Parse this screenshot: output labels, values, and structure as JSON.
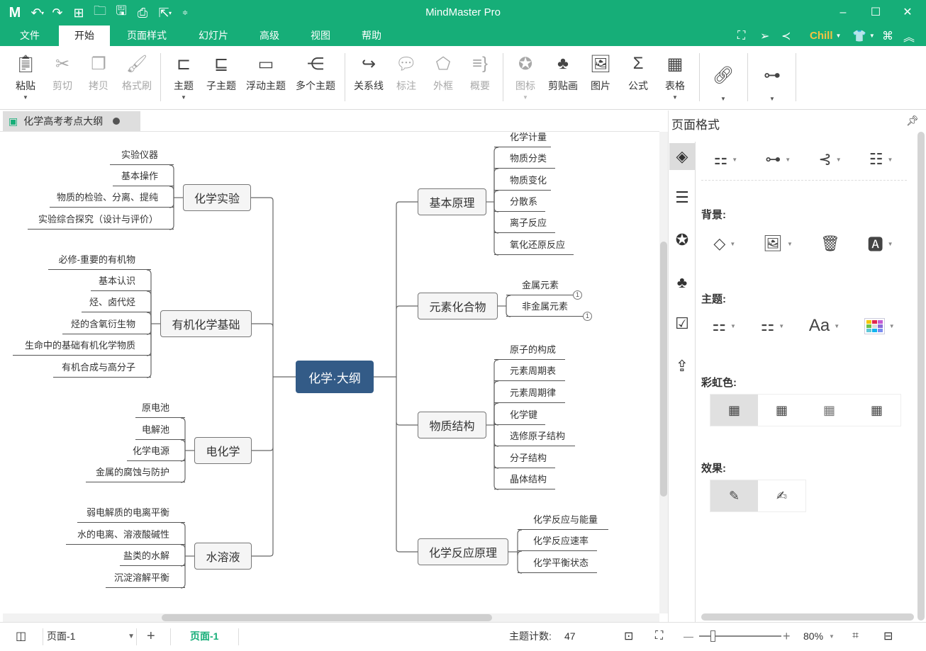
{
  "app": {
    "title": "MindMaster Pro",
    "logo": "M"
  },
  "quick_access": [
    "undo-icon",
    "redo-icon",
    "new-icon",
    "open-icon",
    "save-icon",
    "print-icon",
    "export-icon",
    "customize-icon"
  ],
  "menus": [
    "文件",
    "开始",
    "页面样式",
    "幻灯片",
    "高级",
    "视图",
    "帮助"
  ],
  "active_menu": "开始",
  "theme_label": "Chill",
  "ribbon": {
    "clipboard": [
      {
        "label": "粘贴",
        "icon": "paste-icon",
        "enabled": true,
        "dropdown": true
      },
      {
        "label": "剪切",
        "icon": "cut-icon",
        "enabled": false
      },
      {
        "label": "拷贝",
        "icon": "copy-icon",
        "enabled": false
      },
      {
        "label": "格式刷",
        "icon": "format-painter-icon",
        "enabled": false
      }
    ],
    "topics": [
      {
        "label": "主题",
        "icon": "topic-icon",
        "enabled": true,
        "dropdown": true
      },
      {
        "label": "子主题",
        "icon": "subtopic-icon",
        "enabled": true
      },
      {
        "label": "浮动主题",
        "icon": "floating-topic-icon",
        "enabled": true
      },
      {
        "label": "多个主题",
        "icon": "multiple-topics-icon",
        "enabled": true
      }
    ],
    "annotate": [
      {
        "label": "关系线",
        "icon": "relationship-icon",
        "enabled": true
      },
      {
        "label": "标注",
        "icon": "callout-icon",
        "enabled": false
      },
      {
        "label": "外框",
        "icon": "boundary-icon",
        "enabled": false
      },
      {
        "label": "概要",
        "icon": "summary-icon",
        "enabled": false
      }
    ],
    "insert": [
      {
        "label": "图标",
        "icon": "mark-icon",
        "enabled": false,
        "dropdown": true
      },
      {
        "label": "剪贴画",
        "icon": "clipart-icon",
        "enabled": true
      },
      {
        "label": "图片",
        "icon": "picture-icon",
        "enabled": true
      },
      {
        "label": "公式",
        "icon": "formula-icon",
        "enabled": true
      },
      {
        "label": "表格",
        "icon": "table-icon",
        "enabled": true,
        "dropdown": true
      }
    ],
    "extra": [
      {
        "label": "",
        "icon": "link-icon",
        "dropdown": true
      },
      {
        "label": "",
        "icon": "layout-icon",
        "dropdown": true
      }
    ]
  },
  "document_tab": {
    "title": "化学高考考点大纲",
    "modified": true
  },
  "mindmap": {
    "root": "化学·大纲",
    "left": [
      {
        "title": "化学实验",
        "children": [
          "实验仪器",
          "基本操作",
          "物质的检验、分离、提纯",
          "实验综合探究（设计与评价）"
        ]
      },
      {
        "title": "有机化学基础",
        "children": [
          "必修-重要的有机物",
          "基本认识",
          "烃、卤代烃",
          "烃的含氧衍生物",
          "生命中的基础有机化学物质",
          "有机合成与高分子"
        ]
      },
      {
        "title": "电化学",
        "children": [
          "原电池",
          "电解池",
          "化学电源",
          "金属的腐蚀与防护"
        ]
      },
      {
        "title": "水溶液",
        "children": [
          "弱电解质的电离平衡",
          "水的电离、溶液酸碱性",
          "盐类的水解",
          "沉淀溶解平衡"
        ]
      }
    ],
    "right": [
      {
        "title": "基本原理",
        "children": [
          "化学计量",
          "物质分类",
          "物质变化",
          "分散系",
          "离子反应",
          "氧化还原反应"
        ]
      },
      {
        "title": "元素化合物",
        "children": [
          "金属元素",
          "非金属元素"
        ],
        "badges": [
          "1",
          "1"
        ]
      },
      {
        "title": "物质结构",
        "children": [
          "原子的构成",
          "元素周期表",
          "元素周期律",
          "化学键",
          "选修原子结构",
          "分子结构",
          "晶体结构"
        ]
      },
      {
        "title": "化学反应原理",
        "children": [
          "化学反应与能量",
          "化学反应速率",
          "化学平衡状态"
        ]
      }
    ]
  },
  "panel": {
    "title": "页面格式",
    "sections": {
      "background": "背景:",
      "theme": "主题:",
      "rainbow": "彩虹色:",
      "effect": "效果:"
    },
    "side_tabs": [
      "page-format-icon",
      "outline-icon",
      "icon-library-icon",
      "clipart-library-icon",
      "task-icon",
      "export-icon"
    ]
  },
  "status": {
    "page_select": "页面-1",
    "page_tab": "页面-1",
    "topic_count_label": "主题计数:",
    "topic_count": "47",
    "zoom": "80%",
    "zoom_fraction": 0.14
  },
  "colors": {
    "brand": "#16ae78",
    "root": "#335b87",
    "theme_accent": "#f5c242"
  }
}
